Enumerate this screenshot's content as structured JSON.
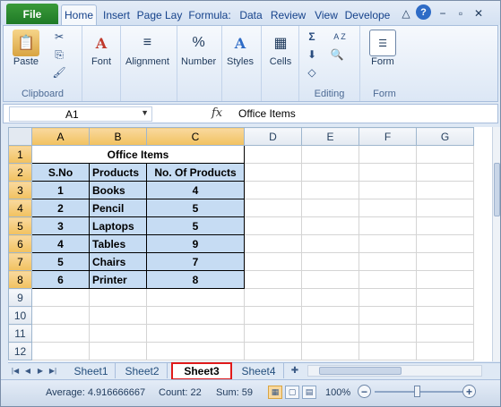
{
  "ribbon": {
    "file_label": "File",
    "tabs": [
      "Home",
      "Insert",
      "Page Lay",
      "Formula:",
      "Data",
      "Review",
      "View",
      "Develope"
    ],
    "groups": {
      "clipboard": {
        "label": "Clipboard",
        "paste": "Paste"
      },
      "font": {
        "label": "Font"
      },
      "alignment": {
        "label": "Alignment"
      },
      "number": {
        "label": "Number"
      },
      "styles": {
        "label": "Styles"
      },
      "cells": {
        "label": "Cells"
      },
      "editing": {
        "label": "Editing",
        "sigma": "Σ",
        "sort": "A Z"
      },
      "form": {
        "label": "Form",
        "button": "Form"
      }
    }
  },
  "formula_bar": {
    "name_box": "A1",
    "fx": "fx",
    "formula": "Office Items"
  },
  "grid": {
    "col_headers": [
      "A",
      "B",
      "C",
      "D",
      "E",
      "F",
      "G"
    ],
    "row_headers": [
      "1",
      "2",
      "3",
      "4",
      "5",
      "6",
      "7",
      "8",
      "9",
      "10",
      "11",
      "12"
    ],
    "title": "Office Items",
    "headers": [
      "S.No",
      "Products",
      "No. Of Products"
    ],
    "rows": [
      [
        "1",
        "Books",
        "4"
      ],
      [
        "2",
        "Pencil",
        "5"
      ],
      [
        "3",
        "Laptops",
        "5"
      ],
      [
        "4",
        "Tables",
        "9"
      ],
      [
        "5",
        "Chairs",
        "7"
      ],
      [
        "6",
        "Printer",
        "8"
      ]
    ]
  },
  "sheets": [
    "Sheet1",
    "Sheet2",
    "Sheet3",
    "Sheet4"
  ],
  "active_sheet": "Sheet3",
  "status": {
    "average": "Average: 4.916666667",
    "count": "Count: 22",
    "sum": "Sum: 59",
    "zoom": "100%",
    "zoom_minus": "−",
    "zoom_plus": "+"
  },
  "colors": {
    "file_tab": "#1f7a26",
    "selection_fill": "#c6dcf3",
    "active_sheet_outline": "#e01a1a"
  }
}
